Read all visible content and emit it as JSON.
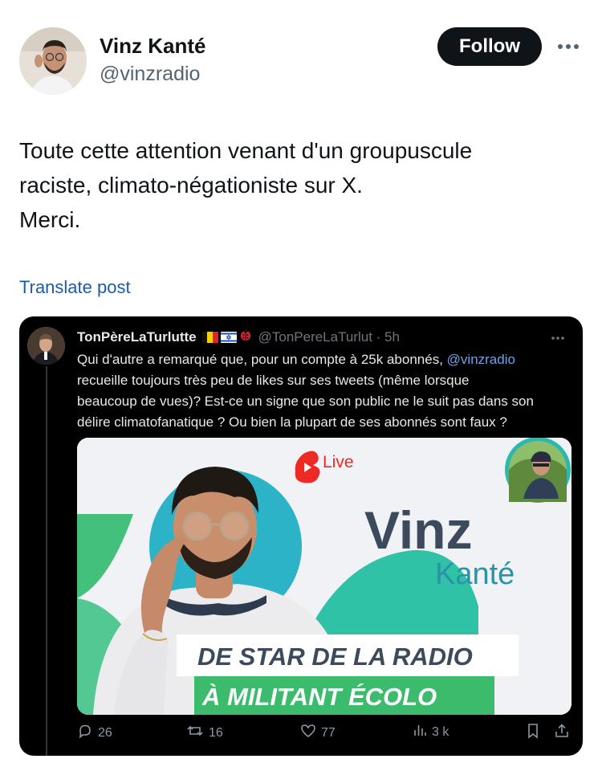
{
  "author": {
    "name": "Vinz Kanté",
    "handle": "@vinzradio"
  },
  "follow_label": "Follow",
  "post": {
    "lines": [
      "Toute cette attention venant d'un groupuscule",
      "raciste, climato-négationiste sur X.",
      "Merci."
    ]
  },
  "translate_label": "Translate post",
  "quoted": {
    "name": "TonPèreLaTurlutte",
    "handle_time": "@TonPereLaTurlut · 5h",
    "text_line1_before": "Qui d'autre a remarqué que, pour un compte à 25k abonnés, ",
    "mention": "@vinzradio",
    "text_lines": [
      "recueille toujours très peu de likes sur ses tweets (même lorsque",
      "beaucoup de vues)? Est-ce un signe que son public ne le suit pas dans son",
      "délire climatofanatique ? Ou bien la plupart de ses abonnés sont faux ?"
    ],
    "media": {
      "live_label": "Live",
      "name_first": "Vinz",
      "name_last": "Kanté",
      "banner_line1": "DE STAR DE LA RADIO",
      "banner_line2": "À MILITANT ÉCOLO",
      "colors": {
        "teal": "#2bb8ad",
        "green": "#3dbb6d",
        "navy": "#3b4a5c",
        "bg": "#f0f2f6"
      }
    },
    "actions": {
      "replies": "26",
      "reposts": "16",
      "likes": "77",
      "views": "3 k"
    }
  }
}
